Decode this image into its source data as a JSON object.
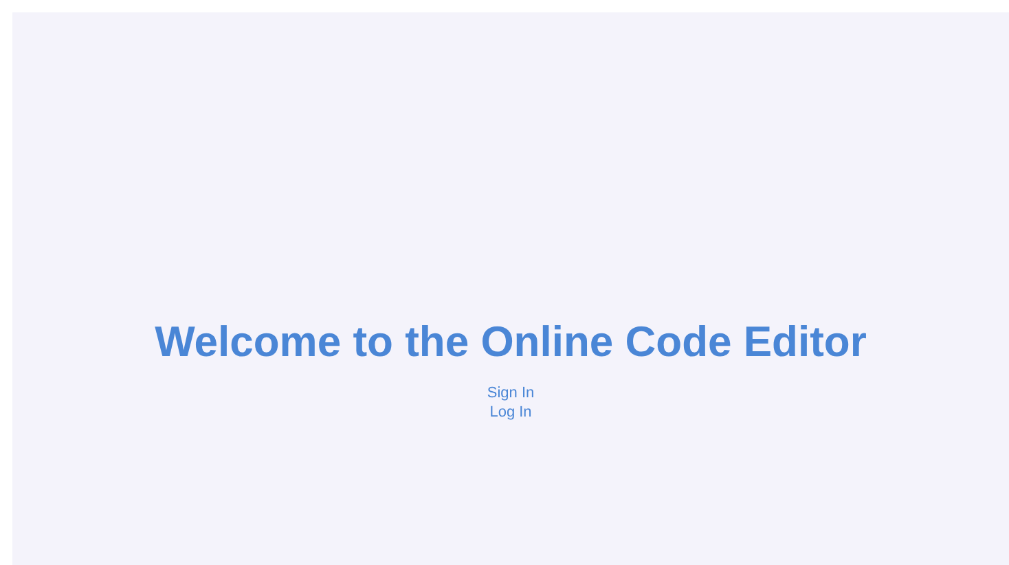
{
  "heading": "Welcome to the Online Code Editor",
  "links": [
    "Sign In",
    "Log In"
  ]
}
